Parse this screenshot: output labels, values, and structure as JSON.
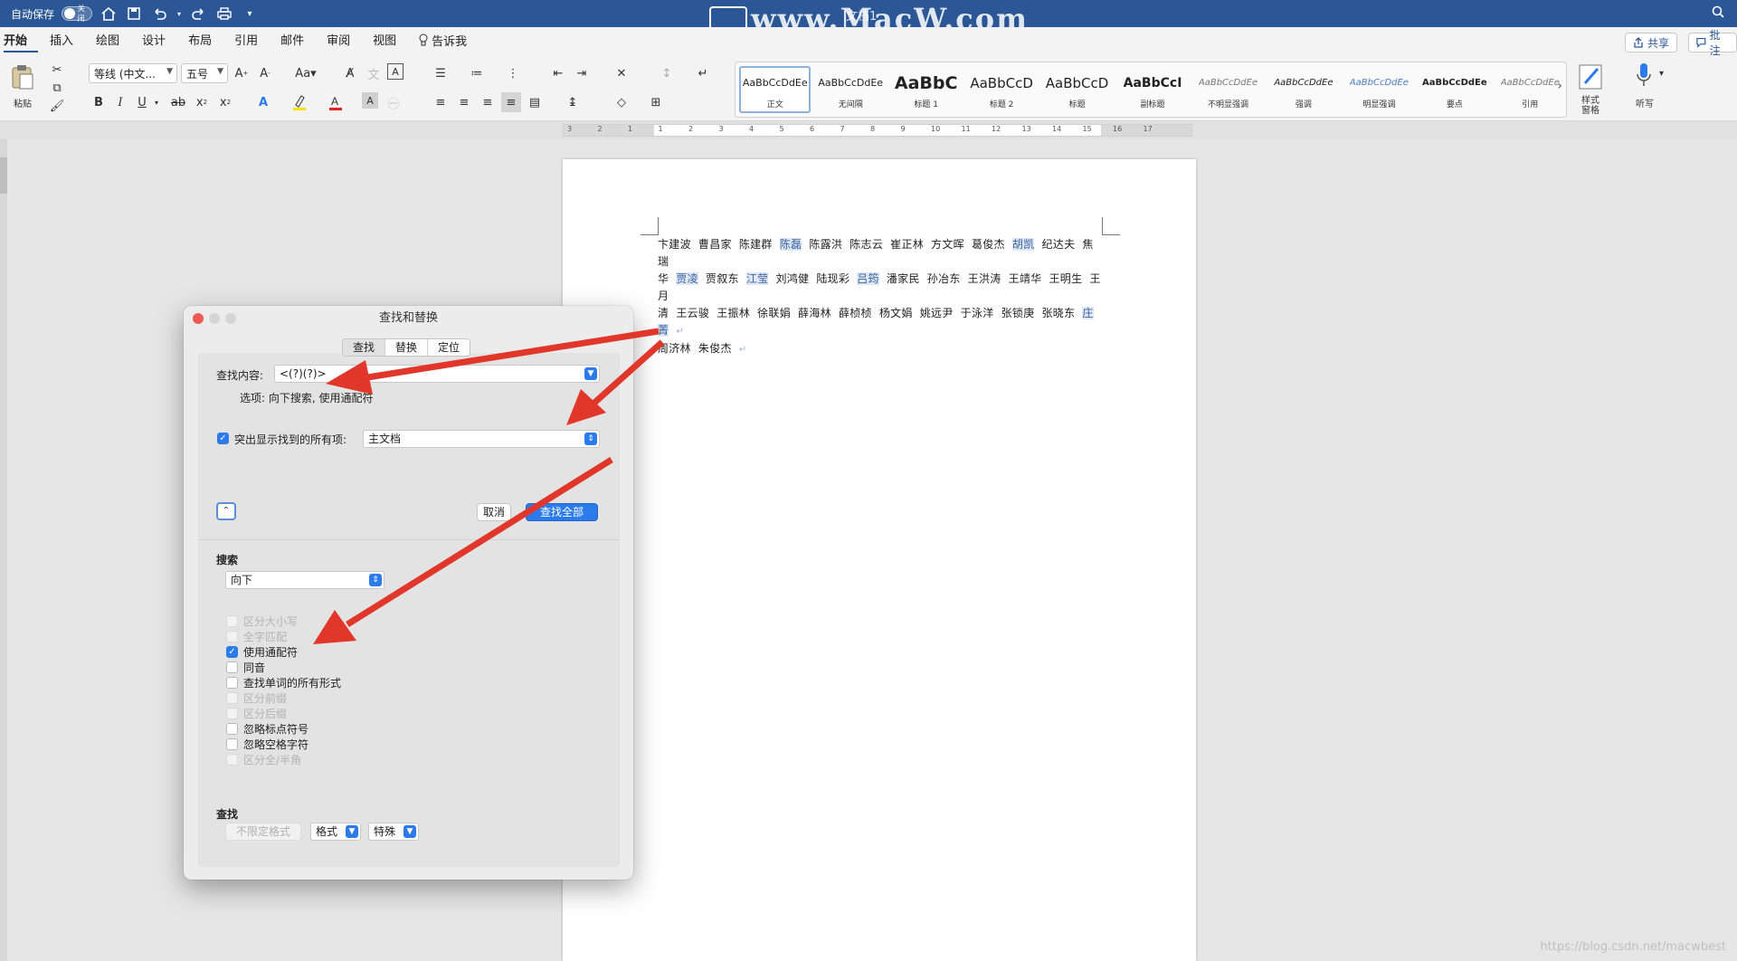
{
  "titlebar": {
    "autosave_label": "自动保存",
    "autosave_toggle": "关闭",
    "doc_title": "文档1",
    "watermark": "www.MacW.com"
  },
  "menu": {
    "tabs": [
      "开始",
      "插入",
      "绘图",
      "设计",
      "布局",
      "引用",
      "邮件",
      "审阅",
      "视图"
    ],
    "tell_me": "告诉我",
    "share": "共享",
    "comments": "批注"
  },
  "ribbon": {
    "paste_label": "粘贴",
    "font_name": "等线 (中文...",
    "font_size": "五号",
    "change_case": "Aa",
    "styles": [
      {
        "sample": "AaBbCcDdEe",
        "name": "正文",
        "style": "normal"
      },
      {
        "sample": "AaBbCcDdEe",
        "name": "无间隔",
        "style": "normal"
      },
      {
        "sample": "AaBbC",
        "name": "标题 1",
        "style": "h1"
      },
      {
        "sample": "AaBbCcD",
        "name": "标题 2",
        "style": "h2"
      },
      {
        "sample": "AaBbCcD",
        "name": "标题",
        "style": "h2"
      },
      {
        "sample": "AaBbCcI",
        "name": "副标题",
        "style": "sub"
      },
      {
        "sample": "AaBbCcDdEe",
        "name": "不明显强调",
        "style": "italic-grey"
      },
      {
        "sample": "AaBbCcDdEe",
        "name": "强调",
        "style": "italic"
      },
      {
        "sample": "AaBbCcDdEe",
        "name": "明显强调",
        "style": "italic-blue"
      },
      {
        "sample": "AaBbCcDdEe",
        "name": "要点",
        "style": "bold"
      },
      {
        "sample": "AaBbCcDdEe",
        "name": "引用",
        "style": "italic-grey"
      }
    ],
    "styles_pane": "样式窗格",
    "dictate": "听写"
  },
  "ruler": {
    "numbers": [
      "3",
      "2",
      "1",
      "1",
      "2",
      "3",
      "4",
      "5",
      "6",
      "7",
      "8",
      "9",
      "10",
      "11",
      "12",
      "13",
      "14",
      "15",
      "16",
      "17"
    ]
  },
  "document": {
    "lines": [
      [
        {
          "t": "卞建波"
        },
        {
          "t": "曹昌家"
        },
        {
          "t": "陈建群"
        },
        {
          "t": "陈磊",
          "hl": true
        },
        {
          "t": "陈露洪"
        },
        {
          "t": "陈志云"
        },
        {
          "t": "崔正林"
        },
        {
          "t": "方文晖"
        },
        {
          "t": "葛俊杰"
        },
        {
          "t": "胡凯",
          "hl": true
        },
        {
          "t": "纪达夫"
        },
        {
          "t": "焦瑞"
        }
      ],
      [
        {
          "t": "华"
        },
        {
          "t": "贾凌",
          "hl": true
        },
        {
          "t": "贾叙东"
        },
        {
          "t": "江莹",
          "hl": true
        },
        {
          "t": "刘鸿健"
        },
        {
          "t": "陆现彩"
        },
        {
          "t": "吕筠",
          "hl": true
        },
        {
          "t": "潘家民"
        },
        {
          "t": "孙冶东"
        },
        {
          "t": "王洪涛"
        },
        {
          "t": "王靖华"
        },
        {
          "t": "王明生"
        },
        {
          "t": "王月"
        }
      ],
      [
        {
          "t": "清"
        },
        {
          "t": "王云骏"
        },
        {
          "t": "王振林"
        },
        {
          "t": "徐联娟"
        },
        {
          "t": "薛海林"
        },
        {
          "t": "薛桢桢"
        },
        {
          "t": "杨文娟"
        },
        {
          "t": "姚远尹"
        },
        {
          "t": "于泳洋"
        },
        {
          "t": "张锁庚"
        },
        {
          "t": "张晓东"
        },
        {
          "t": "庄菁",
          "hl": true,
          "pm": true
        }
      ],
      [
        {
          "t": "周济林"
        },
        {
          "t": "朱俊杰",
          "pm": true
        }
      ]
    ]
  },
  "dialog": {
    "title": "查找和替换",
    "tabs": [
      "查找",
      "替换",
      "定位"
    ],
    "find_label": "查找内容:",
    "find_value": "<(?)(?)>",
    "options_line": "选项:  向下搜索, 使用通配符",
    "highlight_label": "突出显示找到的所有项:",
    "highlight_scope": "主文档",
    "cancel": "取消",
    "find_all": "查找全部",
    "search_section": "搜索",
    "search_direction": "向下",
    "options": [
      {
        "label": "区分大小写",
        "checked": false,
        "disabled": true
      },
      {
        "label": "全字匹配",
        "checked": false,
        "disabled": true
      },
      {
        "label": "使用通配符",
        "checked": true,
        "disabled": false
      },
      {
        "label": "同音",
        "checked": false,
        "disabled": false
      },
      {
        "label": "查找单词的所有形式",
        "checked": false,
        "disabled": false
      },
      {
        "label": "区分前缀",
        "checked": false,
        "disabled": true
      },
      {
        "label": "区分后缀",
        "checked": false,
        "disabled": true
      },
      {
        "label": "忽略标点符号",
        "checked": false,
        "disabled": false
      },
      {
        "label": "忽略空格字符",
        "checked": false,
        "disabled": false
      },
      {
        "label": "区分全/半角",
        "checked": false,
        "disabled": true
      }
    ],
    "find_section": "查找",
    "no_format": "不限定格式",
    "format": "格式",
    "special": "特殊"
  },
  "footer": {
    "csdn": "https://blog.csdn.net/macwbest"
  },
  "colors": {
    "titlebar": "#2b5797",
    "accent": "#2b7bea",
    "arrow": "#e0372a",
    "highlight": "#dde8f4"
  }
}
